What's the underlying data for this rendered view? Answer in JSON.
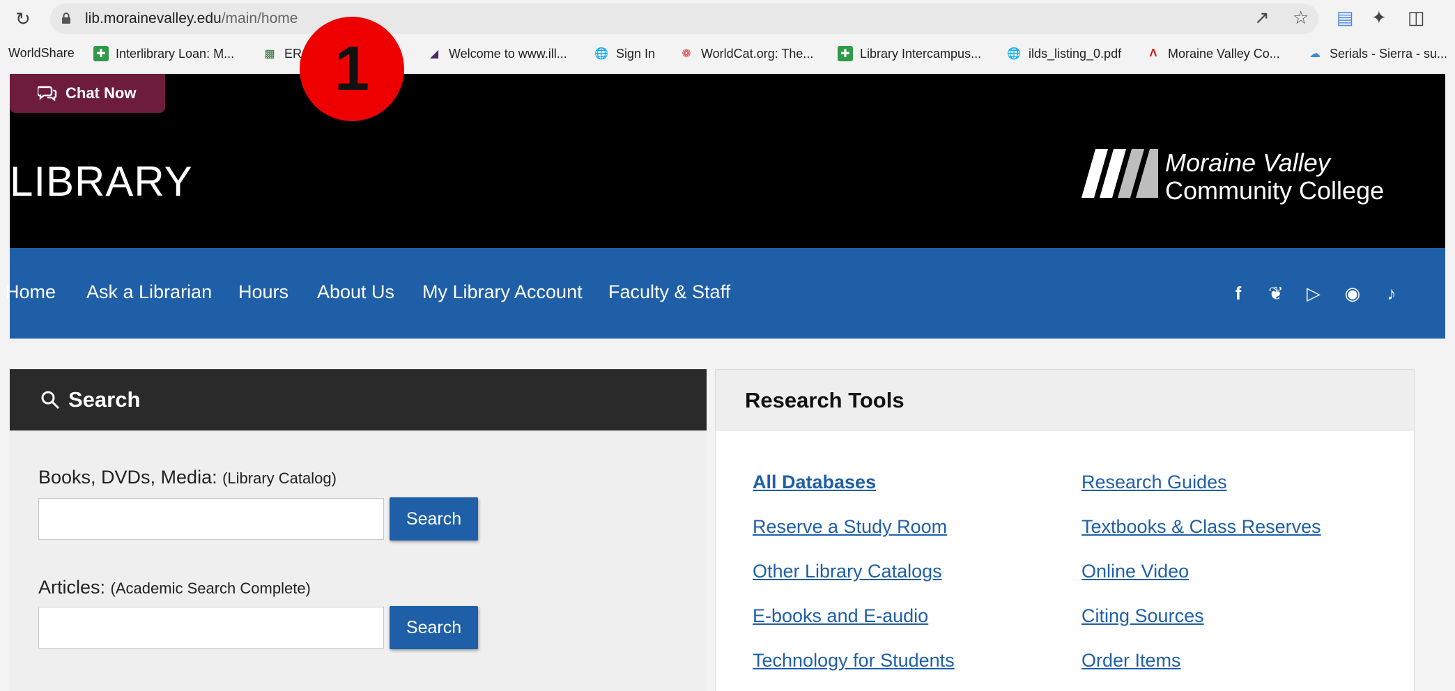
{
  "browser": {
    "url_domain": "lib.morainevalley.edu",
    "url_path": "/main/home",
    "bookmarks": [
      {
        "label": "WorldShare",
        "icon": "none"
      },
      {
        "label": "Interlibrary Loan: M...",
        "icon": "green-plus-icon"
      },
      {
        "label": "ERM Databa... (partially hidden)",
        "icon": "blocks-icon"
      },
      {
        "label": "Welcome to www.ill...",
        "icon": "triangle-icon"
      },
      {
        "label": "Sign In",
        "icon": "globe-icon"
      },
      {
        "label": "WorldCat.org: The...",
        "icon": "worldcat-icon"
      },
      {
        "label": "Library Intercampus...",
        "icon": "green-plus-icon"
      },
      {
        "label": "ilds_listing_0.pdf",
        "icon": "globe-icon"
      },
      {
        "label": "Moraine Valley Co...",
        "icon": "mvcc-icon"
      },
      {
        "label": "Serials - Sierra - su...",
        "icon": "cloud-icon"
      }
    ]
  },
  "header": {
    "chat_label": "Chat Now",
    "title": "LIBRARY",
    "logo_line1": "Moraine Valley",
    "logo_line2": "Community College"
  },
  "nav": {
    "items": [
      "Home",
      "Ask a Librarian",
      "Hours",
      "About Us",
      "My Library Account",
      "Faculty & Staff"
    ],
    "social_icons": [
      "facebook-icon",
      "twitter-icon",
      "youtube-icon",
      "instagram-icon",
      "tiktok-icon"
    ]
  },
  "search": {
    "heading": "Search",
    "books_label": "Books, DVDs, Media:",
    "books_sub": "(Library Catalog)",
    "articles_label": "Articles:",
    "articles_sub": "(Academic Search Complete)",
    "button_label": "Search",
    "books_value": "",
    "articles_value": ""
  },
  "tools": {
    "heading": "Research Tools",
    "left": [
      "All Databases",
      "Reserve a Study Room",
      "Other Library Catalogs",
      "E-books and E-audio",
      "Technology for Students"
    ],
    "right": [
      "Research Guides",
      "Textbooks & Class Reserves",
      "Online Video",
      "Citing Sources",
      "Order Items"
    ]
  },
  "marker": {
    "number": "1",
    "color": "#ee0000"
  },
  "colors": {
    "nav_blue": "#1f5fa8",
    "chat_maroon": "#6d1c3d",
    "header_black": "#000000"
  }
}
